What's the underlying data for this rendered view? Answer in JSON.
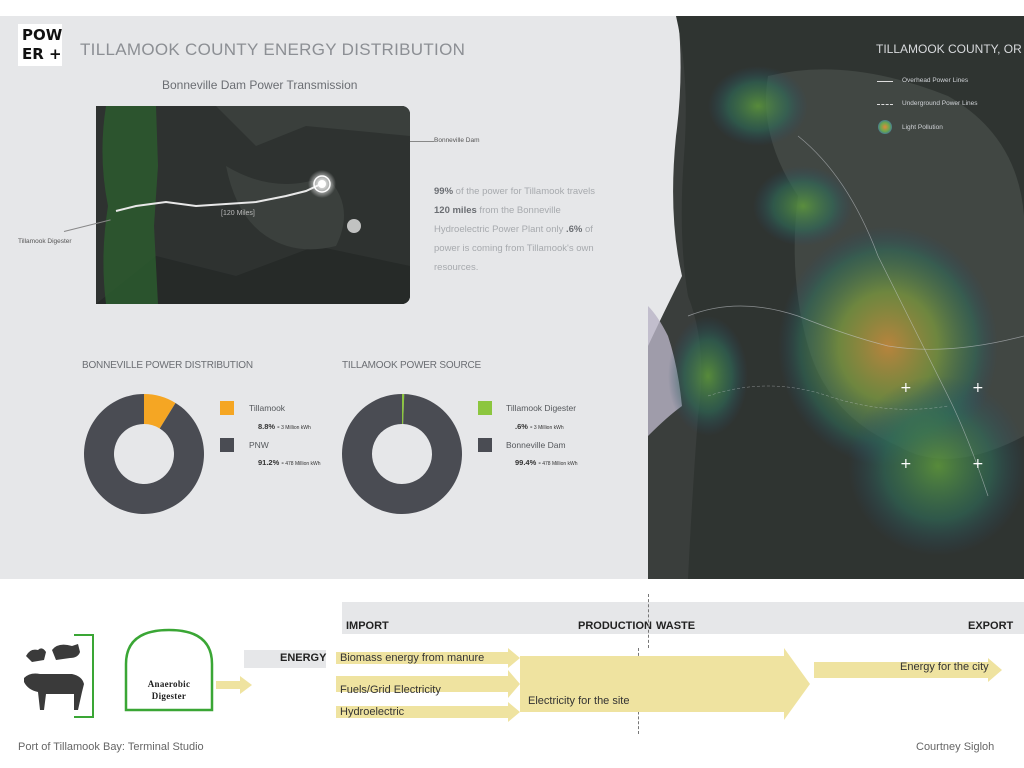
{
  "header": {
    "logo_line1": "POW",
    "logo_line2": "ER +",
    "title": "TILLAMOOK COUNTY ENERGY DISTRIBUTION",
    "subtitle": "Bonneville Dam Power Transmission"
  },
  "small_map": {
    "label_dam": "Bonneville Dam",
    "label_digester": "Tillamook Digester",
    "label_distance": "[120 Miles]"
  },
  "description": {
    "p1_a": "99%",
    "p1_b": " of the power for Tillamook travels ",
    "p1_c": "120 miles",
    "p1_d": " from the Bonneville Hydroelectric Power Plant only ",
    "p1_e": ".6%",
    "p1_f": " of power is coming from Tillamook's own resources."
  },
  "bonneville": {
    "heading": "BONNEVILLE POWER DISTRIBUTION",
    "items": [
      {
        "label": "Tillamook",
        "pct": "8.8% -",
        "amount": " 3 Million kWh",
        "color": "#f5a623"
      },
      {
        "label": "PNW",
        "pct": "91.2% -",
        "amount": " 478 Million kWh",
        "color": "#4a4c53"
      }
    ]
  },
  "tillamook_source": {
    "heading": "TILLAMOOK POWER SOURCE",
    "items": [
      {
        "label": "Tillamook Digester",
        "pct": ".6% -",
        "amount": " 3 Million kWh",
        "color": "#8cc63f"
      },
      {
        "label": "Bonneville Dam",
        "pct": "99.4% -",
        "amount": " 478 Million kWh",
        "color": "#4a4c53"
      }
    ]
  },
  "chart_data": [
    {
      "type": "pie",
      "title": "BONNEVILLE POWER DISTRIBUTION",
      "categories": [
        "Tillamook",
        "PNW"
      ],
      "values": [
        8.8,
        91.2
      ],
      "colors": [
        "#f5a623",
        "#4a4c53"
      ]
    },
    {
      "type": "pie",
      "title": "TILLAMOOK POWER SOURCE",
      "categories": [
        "Tillamook Digester",
        "Bonneville Dam"
      ],
      "values": [
        0.6,
        99.4
      ],
      "colors": [
        "#8cc63f",
        "#4a4c53"
      ]
    }
  ],
  "big_map": {
    "title": "TILLAMOOK COUNTY, OR",
    "legend": [
      "Overhead Power Lines",
      "Underground Power Lines",
      "Light Pollution"
    ]
  },
  "flow": {
    "import": "IMPORT",
    "production": "PRODUCTION",
    "waste": "WASTE",
    "export": "EXPORT",
    "energy": "ENERGY",
    "digester_line1": "Anaerobic",
    "digester_line2": "Digester",
    "inputs": [
      "Biomass energy from manure",
      "Fuels/Grid Electricity",
      "Hydroelectric"
    ],
    "production_output": "Electricity for the site",
    "export_output": "Energy for the city"
  },
  "footer": {
    "left": "Port of Tillamook Bay: Terminal Studio",
    "right": "Courtney Sigloh"
  }
}
